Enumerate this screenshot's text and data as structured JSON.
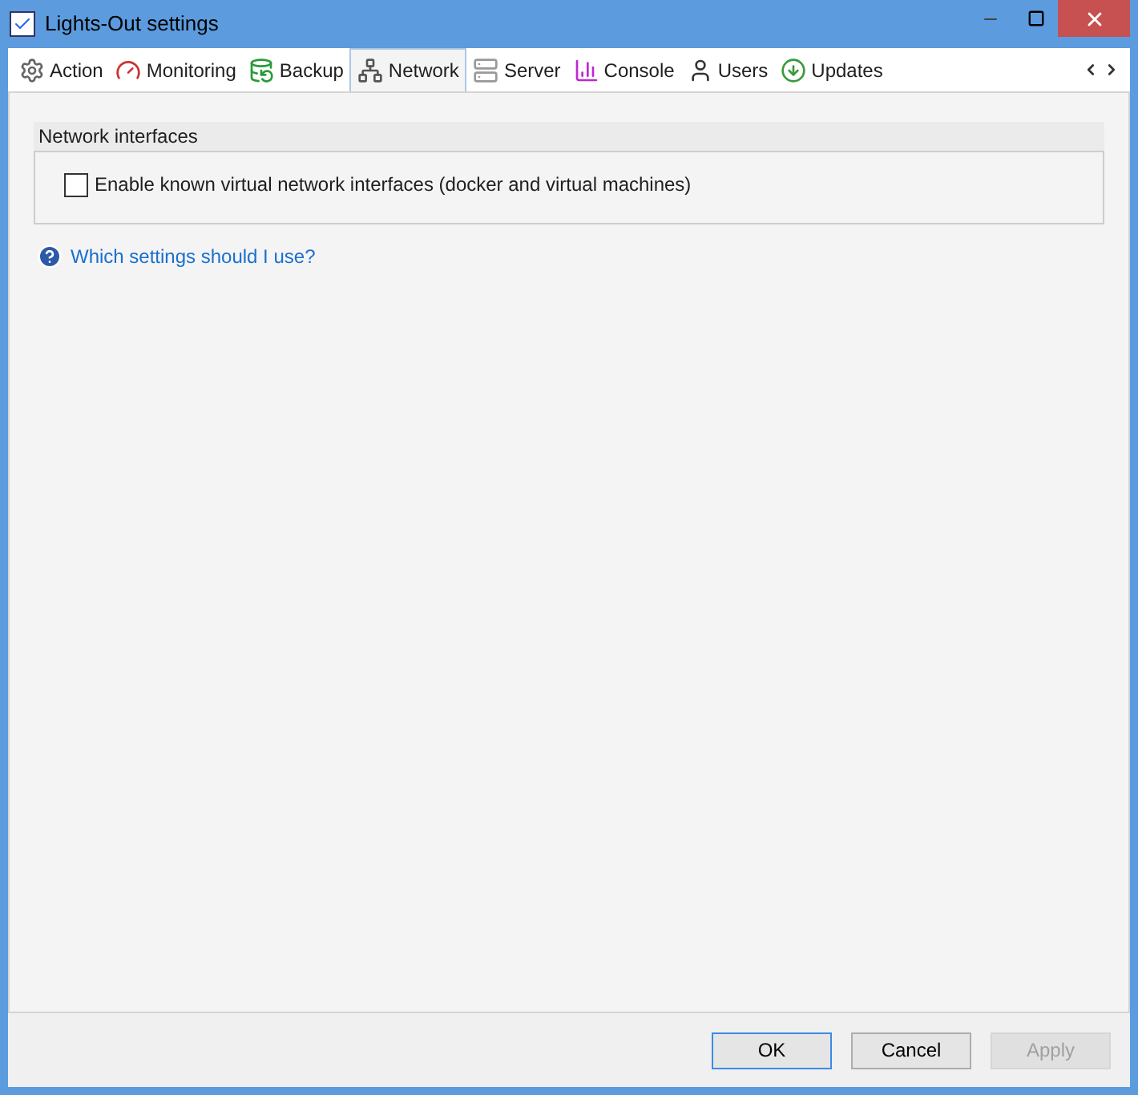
{
  "window": {
    "title": "Lights-Out settings"
  },
  "tabs": [
    {
      "label": "Action",
      "selected": false
    },
    {
      "label": "Monitoring",
      "selected": false
    },
    {
      "label": "Backup",
      "selected": false
    },
    {
      "label": "Network",
      "selected": true
    },
    {
      "label": "Server",
      "selected": false
    },
    {
      "label": "Console",
      "selected": false
    },
    {
      "label": "Users",
      "selected": false
    },
    {
      "label": "Updates",
      "selected": false
    }
  ],
  "group": {
    "title": "Network interfaces",
    "options": [
      {
        "label": "Enable known virtual network interfaces (docker and virtual machines)",
        "checked": false
      }
    ]
  },
  "help_link": "Which settings should I use?",
  "buttons": [
    {
      "label": "OK",
      "default": true,
      "disabled": false
    },
    {
      "label": "Cancel",
      "default": false,
      "disabled": false
    },
    {
      "label": "Apply",
      "default": false,
      "disabled": true
    }
  ]
}
